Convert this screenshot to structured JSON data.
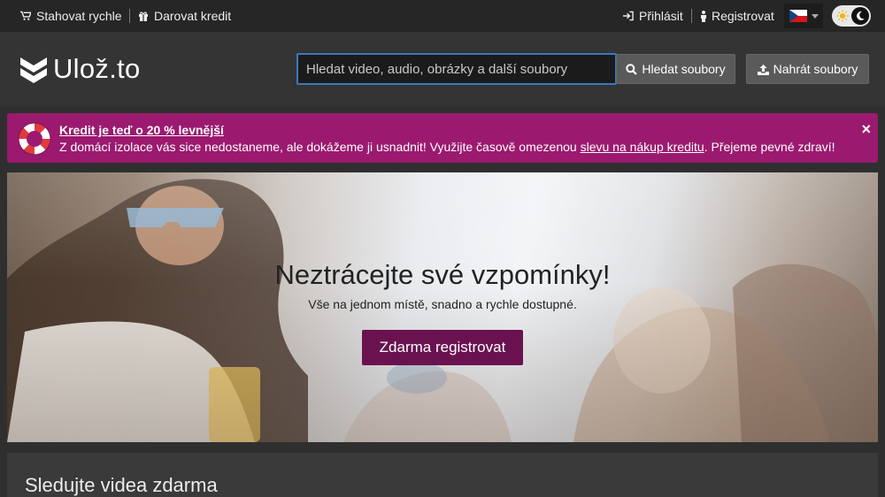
{
  "topbar": {
    "fast_download": "Stahovat rychle",
    "donate_credit": "Darovat kredit",
    "login": "Přihlásit",
    "register": "Registrovat",
    "language": "cz-flag"
  },
  "header": {
    "logo_text": "Ulož.to",
    "search_placeholder": "Hledat video, audio, obrázky a další soubory",
    "search_button": "Hledat soubory",
    "upload_button": "Nahrát soubory"
  },
  "promo": {
    "title": "Kredit je teď o 20 % levnější",
    "text_before": "Z domácí izolace vás sice nedostaneme, ale dokážeme ji usnadnit! Využijte časově omezenou ",
    "link": "slevu na nákup kreditu",
    "text_after": ". Přejeme pevné zdraví!",
    "close": "×"
  },
  "hero": {
    "title": "Neztrácejte své vzpomínky!",
    "subtitle": "Vše na jednom místě, snadno a rychle dostupné.",
    "button": "Zdarma registrovat"
  },
  "section": {
    "title": "Sledujte videa zdarma"
  },
  "colors": {
    "topbar": "#262626",
    "header": "#343434",
    "search_border": "#3a78c2",
    "promo": "#9b1a6f",
    "cta": "#6a1250"
  }
}
